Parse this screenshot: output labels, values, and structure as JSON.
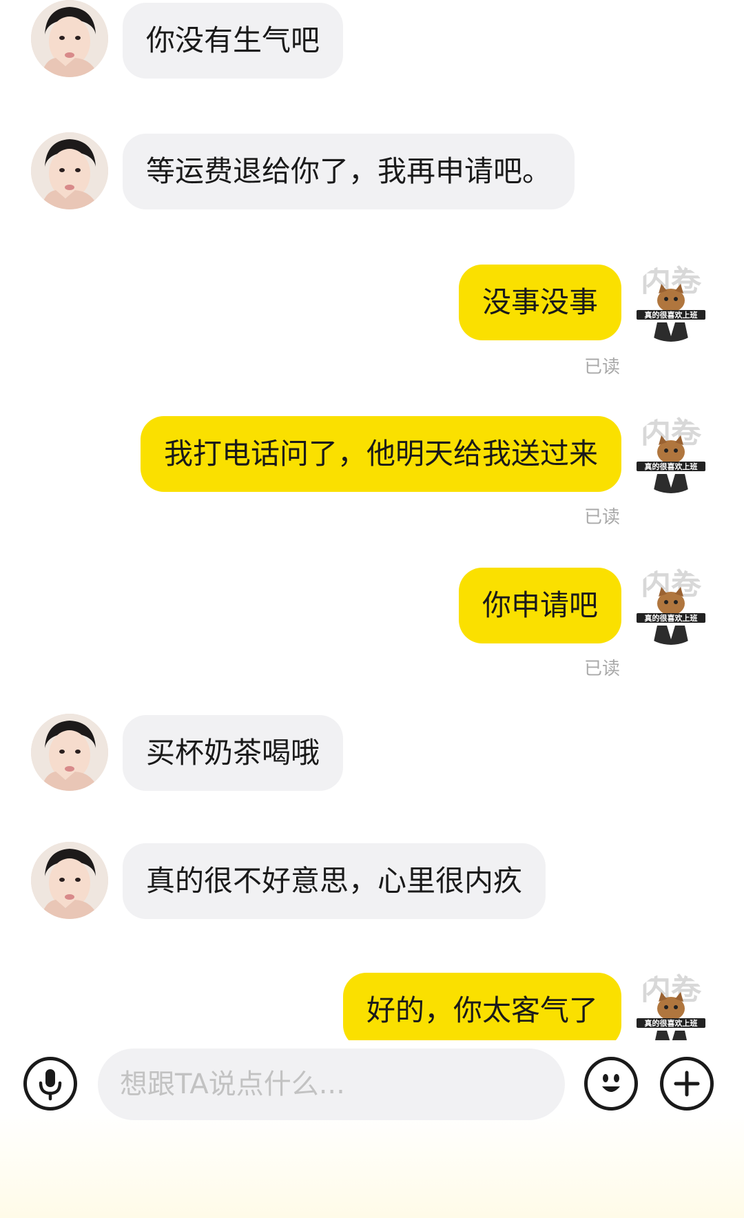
{
  "messages": [
    {
      "side": "in",
      "text": "你没有生气吧"
    },
    {
      "side": "in",
      "text": "等运费退给你了，我再申请吧。"
    },
    {
      "side": "out",
      "text": "没事没事",
      "status": "已读"
    },
    {
      "side": "out",
      "text": "我打电话问了，他明天给我送过来",
      "status": "已读"
    },
    {
      "side": "out",
      "text": "你申请吧",
      "status": "已读"
    },
    {
      "side": "in",
      "text": "买杯奶茶喝哦"
    },
    {
      "side": "in",
      "text": "真的很不好意思，心里很内疚"
    },
    {
      "side": "out",
      "text": "好的，你太客气了"
    }
  ],
  "avatar_right_caption": "真的很喜欢上班",
  "avatar_right_watermark": "内卷",
  "input": {
    "placeholder": "想跟TA说点什么..."
  },
  "icons": {
    "voice": "microphone-icon",
    "emoji": "emoji-icon",
    "more": "plus-icon"
  },
  "colors": {
    "bubble_out": "#fae000",
    "bubble_in": "#f1f1f3",
    "read_status": "#a9a9a9"
  }
}
